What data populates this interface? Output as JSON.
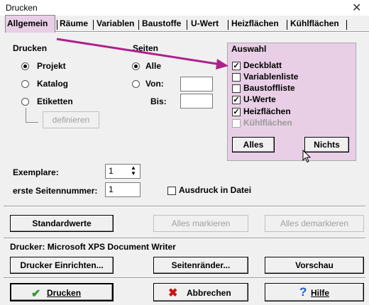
{
  "window": {
    "title": "Drucken",
    "close_label": "✕"
  },
  "tabs": [
    {
      "label": "Allgemein"
    },
    {
      "label": "Räume"
    },
    {
      "label": "Variablen"
    },
    {
      "label": "Baustoffe"
    },
    {
      "label": "U-Wert"
    },
    {
      "label": "Heizflächen"
    },
    {
      "label": "Kühlflächen"
    }
  ],
  "drucken_group": {
    "title": "Drucken",
    "options": [
      {
        "label": "Projekt",
        "selected": true
      },
      {
        "label": "Katalog",
        "selected": false
      },
      {
        "label": "Etiketten",
        "selected": false
      }
    ],
    "definieren_label": "definieren"
  },
  "seiten_group": {
    "title": "Seiten",
    "alle_label": "Alle",
    "von_label": "Von:",
    "bis_label": "Bis:",
    "von_value": "",
    "bis_value": ""
  },
  "auswahl_group": {
    "title": "Auswahl",
    "items": [
      {
        "label": "Deckblatt",
        "checked": true,
        "enabled": true
      },
      {
        "label": "Variablenliste",
        "checked": false,
        "enabled": true
      },
      {
        "label": "Baustoffliste",
        "checked": false,
        "enabled": true
      },
      {
        "label": "U-Werte",
        "checked": true,
        "enabled": true
      },
      {
        "label": "Heizflächen",
        "checked": true,
        "enabled": true
      },
      {
        "label": "Kühlflächen",
        "checked": false,
        "enabled": false
      }
    ],
    "alles_label": "Alles",
    "nichts_label": "Nichts"
  },
  "copies": {
    "label": "Exemplare:",
    "value": "1"
  },
  "first_page": {
    "label": "erste Seitennummer:",
    "value": "1"
  },
  "print_to_file": {
    "label": "Ausdruck in Datei",
    "checked": false
  },
  "buttons_row1": {
    "standardwerte": "Standardwerte",
    "alles_markieren": "Alles markieren",
    "alles_demarkieren": "Alles demarkieren"
  },
  "printer": {
    "label": "Drucker: Microsoft XPS Document Writer"
  },
  "buttons_row2": {
    "drucker_einrichten": "Drucker Einrichten...",
    "seitenraender": "Seitenränder...",
    "vorschau": "Vorschau"
  },
  "buttons_row3": {
    "drucken": "Drucken",
    "abbrechen": "Abbrechen",
    "hilfe": "Hilfe"
  },
  "colors": {
    "highlight": "#e8cfe6",
    "arrow": "#b0208a",
    "check_green": "#2a9a2a",
    "cancel_red": "#cc1010",
    "help_blue": "#1a5fd0"
  }
}
